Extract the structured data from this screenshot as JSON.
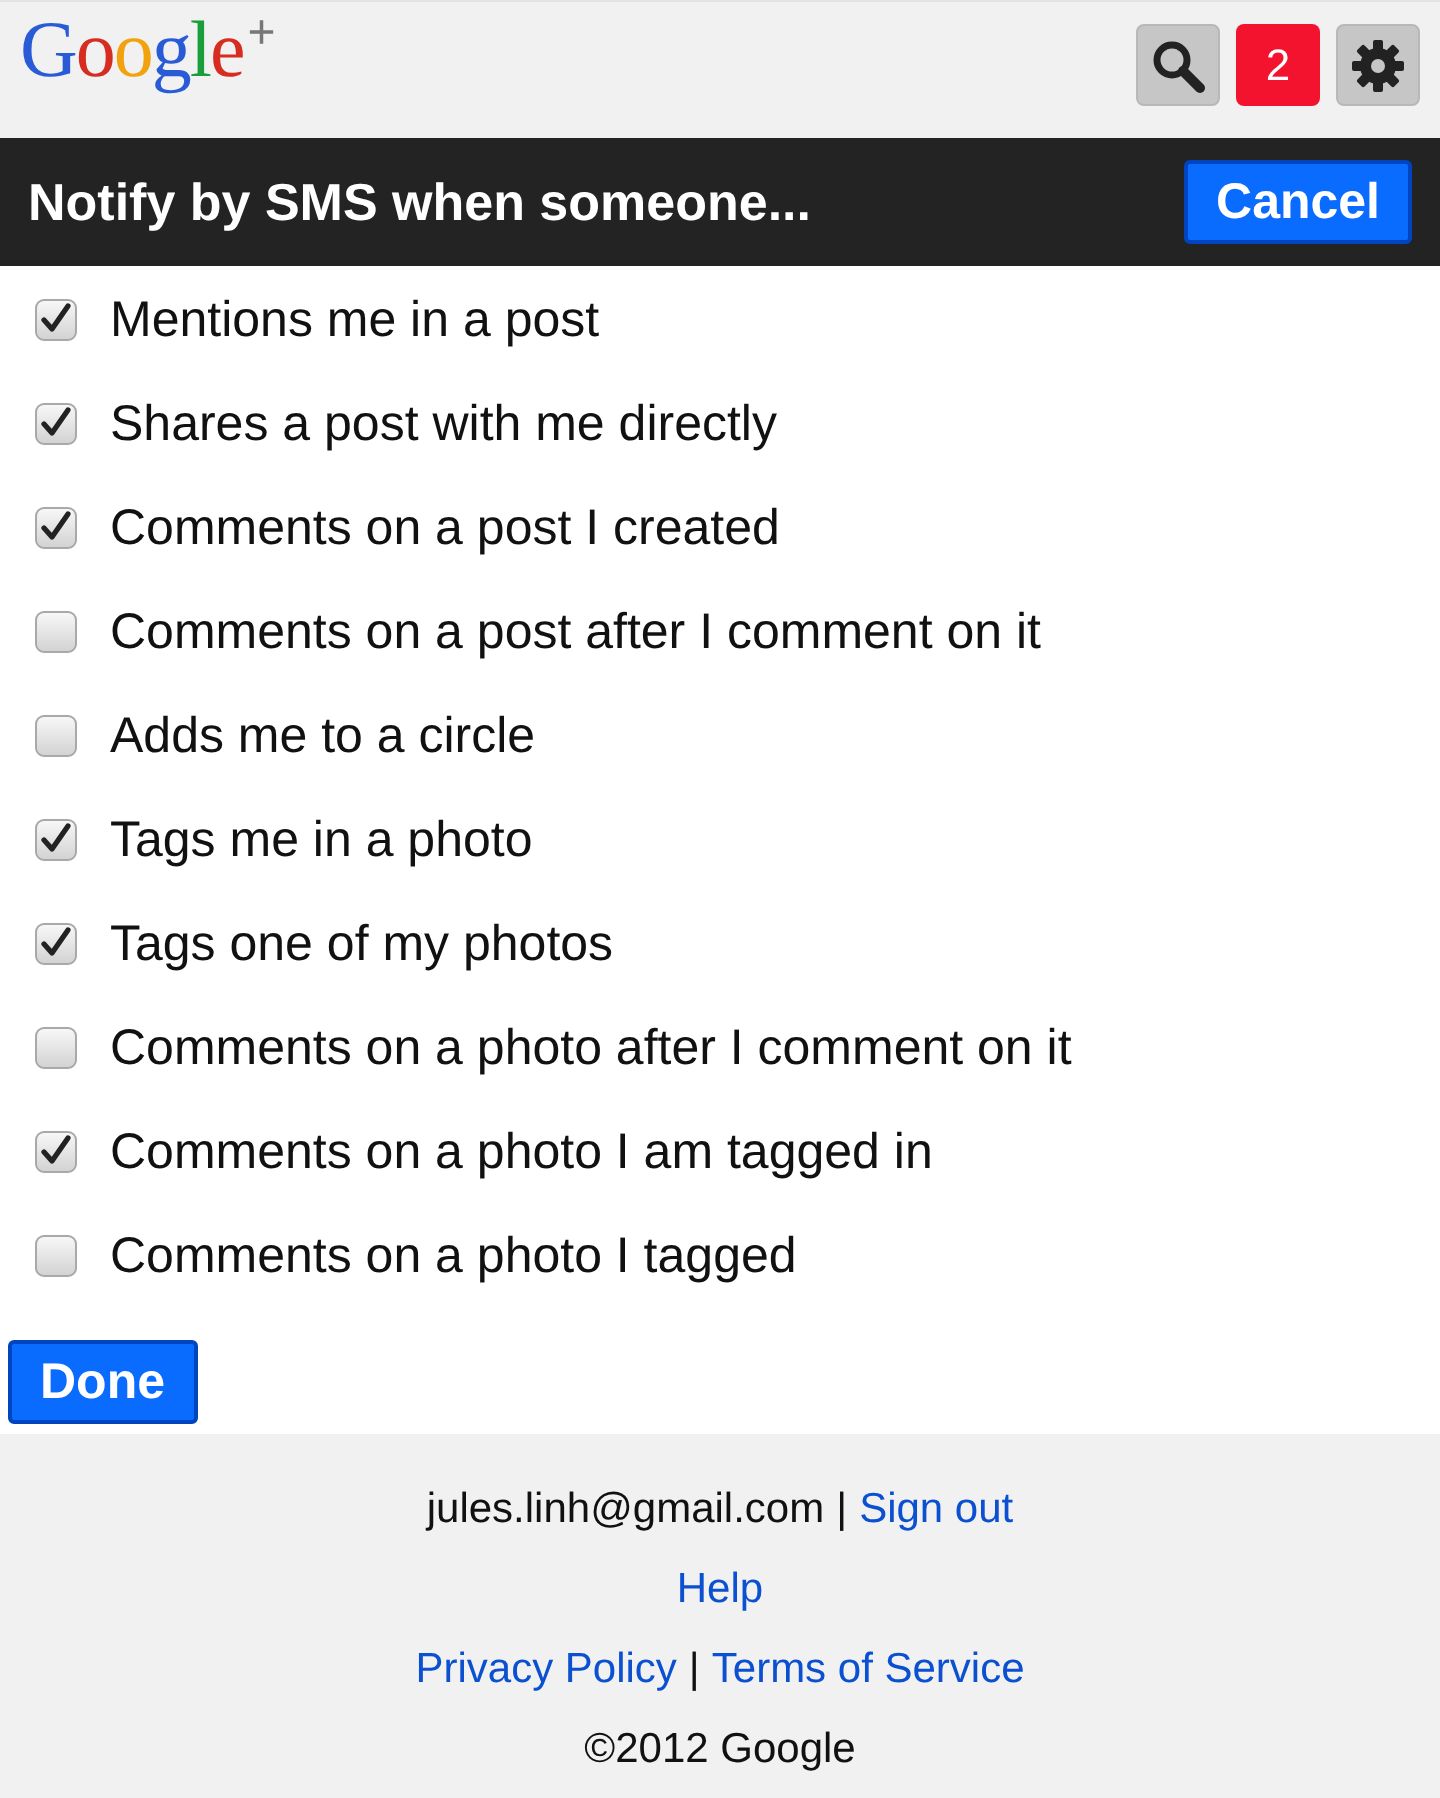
{
  "header": {
    "logo": "Google$^{+}$",
    "notification_count": "2"
  },
  "dialog": {
    "title": "Notify by SMS when someone...",
    "cancel": "Cancel"
  },
  "options": [
    {
      "label": "Mentions me in a post",
      "checked": true
    },
    {
      "label": "Shares a post with me directly",
      "checked": true
    },
    {
      "label": "Comments on a post I created",
      "checked": true
    },
    {
      "label": "Comments on a post after I comment on it",
      "checked": false
    },
    {
      "label": "Adds me to a circle",
      "checked": false
    },
    {
      "label": "Tags me in a photo",
      "checked": true
    },
    {
      "label": "Tags one of my photos",
      "checked": true
    },
    {
      "label": "Comments on a photo after I comment on it",
      "checked": false
    },
    {
      "label": "Comments on a photo I am tagged in",
      "checked": true
    },
    {
      "label": "Comments on a photo I tagged",
      "checked": false
    }
  ],
  "done": "Done",
  "footer": {
    "lines": [
      [
        {
          "kind": "text",
          "text": "jules.linh@gmail.com"
        },
        {
          "kind": "separator",
          "text": "|"
        },
        {
          "kind": "link",
          "text": "Sign out"
        }
      ],
      [
        {
          "kind": "link",
          "text": "Help"
        }
      ],
      [
        {
          "kind": "link",
          "text": "Privacy Policy"
        },
        {
          "kind": "separator",
          "text": "|"
        },
        {
          "kind": "link",
          "text": "Terms of Service"
        }
      ],
      [
        {
          "kind": "text",
          "text": "©2012 Google"
        }
      ]
    ]
  }
}
